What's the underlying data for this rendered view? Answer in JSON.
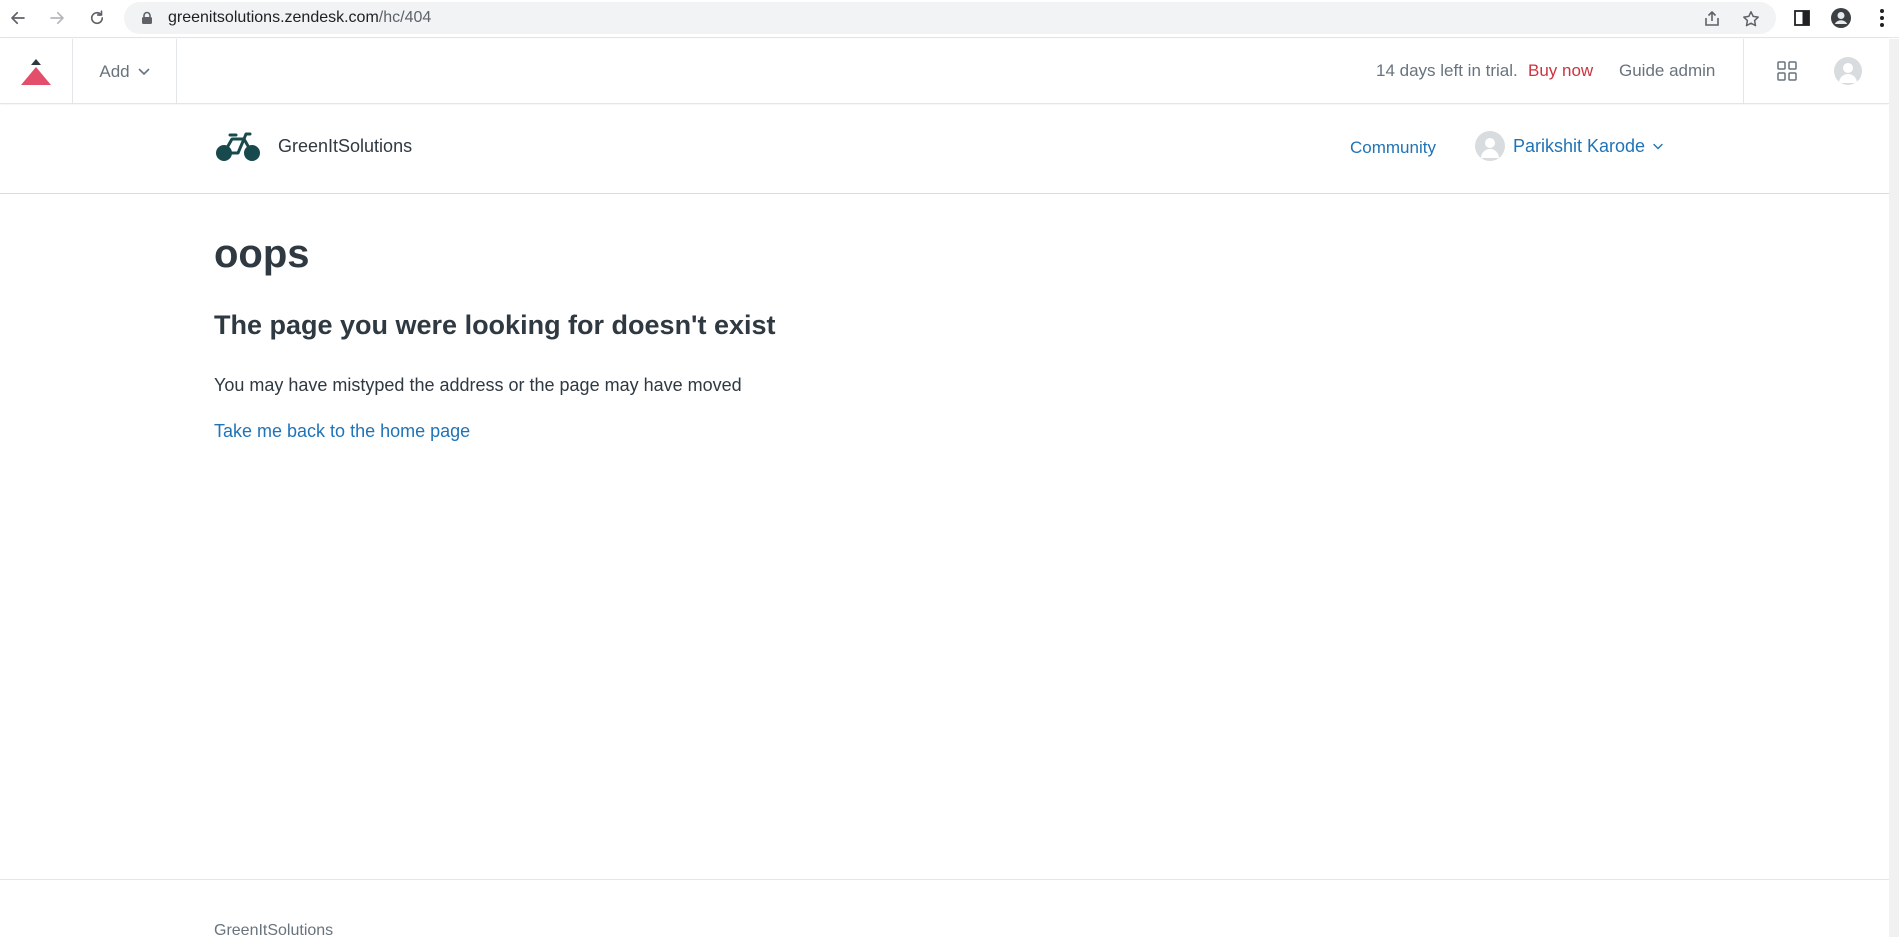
{
  "browser": {
    "url_host": "greenitsolutions.zendesk.com",
    "url_path": "/hc/404"
  },
  "admin_bar": {
    "add_label": "Add",
    "trial_text": "14 days left in trial.",
    "buy_now": "Buy now",
    "guide_admin": "Guide admin"
  },
  "header": {
    "brand_name": "GreenItSolutions",
    "community": "Community",
    "user_name": "Parikshit Karode"
  },
  "main": {
    "title": "oops",
    "subtitle": "The page you were looking for doesn't exist",
    "description": "You may have mistyped the address or the page may have moved",
    "home_link": "Take me back to the home page"
  },
  "footer": {
    "brand_name": "GreenItSolutions"
  },
  "colors": {
    "link": "#1f73b7",
    "buy_now": "#cc3340",
    "logo_accent": "#e34f6a",
    "brand_dark": "#17494d"
  },
  "icons": [
    "back-arrow-icon",
    "forward-arrow-icon",
    "reload-icon",
    "lock-icon",
    "share-icon",
    "star-icon",
    "sidebar-icon",
    "profile-icon",
    "kebab-menu-icon",
    "zendesk-logo-icon",
    "chevron-down-icon",
    "apps-grid-icon",
    "avatar-icon",
    "bicycle-logo-icon"
  ]
}
